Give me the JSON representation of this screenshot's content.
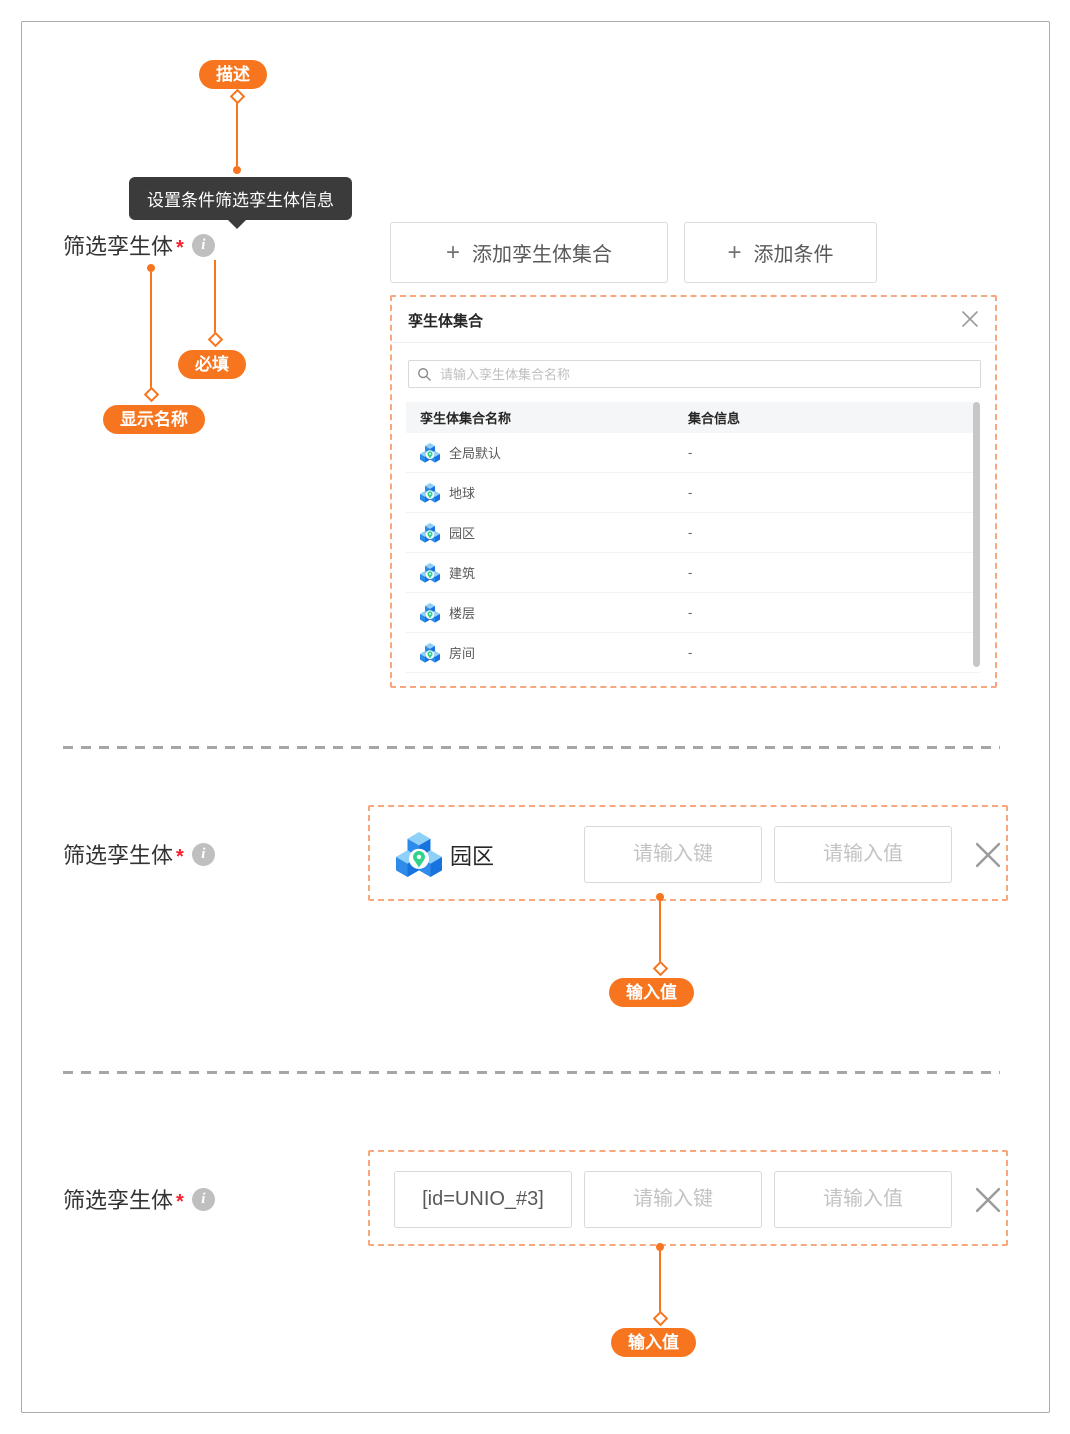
{
  "colors": {
    "accent": "#F7751E",
    "dashed_border": "#F8A77E",
    "tooltip_bg": "#3B3B3B"
  },
  "annotations": {
    "describe_badge": "描述",
    "required_badge": "必填",
    "display_name_badge": "显示名称",
    "input_value_badge_1": "输入值",
    "input_value_badge_2": "输入值"
  },
  "tooltip_text": "设置条件筛选孪生体信息",
  "field": {
    "label": "筛选孪生体",
    "required_mark": "*",
    "info_glyph": "i"
  },
  "toolbar": {
    "plus_glyph": "+",
    "add_collection_label": "添加孪生体集合",
    "add_condition_label": "添加条件"
  },
  "panel": {
    "title": "孪生体集合",
    "search_placeholder": "请输入孪生体集合名称",
    "columns": {
      "name": "孪生体集合名称",
      "info": "集合信息"
    },
    "rows": [
      {
        "name": "全局默认",
        "info": "-"
      },
      {
        "name": "地球",
        "info": "-"
      },
      {
        "name": "园区",
        "info": "-"
      },
      {
        "name": "建筑",
        "info": "-"
      },
      {
        "name": "楼层",
        "info": "-"
      },
      {
        "name": "房间",
        "info": "-"
      }
    ]
  },
  "condition_row_1": {
    "label": "筛选孪生体",
    "required_mark": "*",
    "entity_name": "园区",
    "key_placeholder": "请输入键",
    "value_placeholder": "请输入值"
  },
  "condition_row_2": {
    "label": "筛选孪生体",
    "required_mark": "*",
    "entity_value": "[id=UNIO_#3]",
    "key_placeholder": "请输入键",
    "value_placeholder": "请输入值"
  }
}
